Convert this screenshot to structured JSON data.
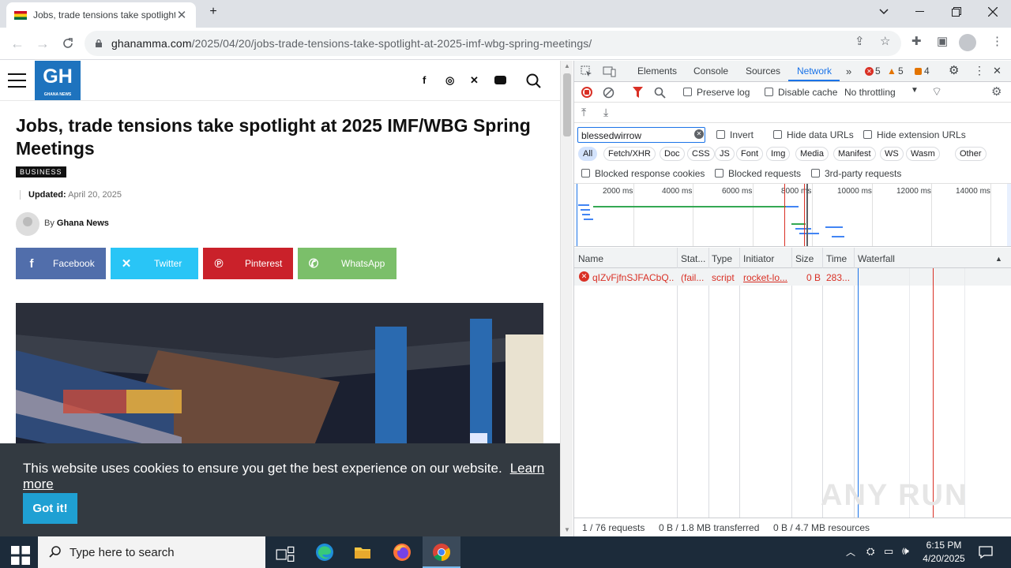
{
  "browser": {
    "tab_title": "Jobs, trade tensions take spotlight",
    "url_domain": "ghanamma.com",
    "url_path": "/2025/04/20/jobs-trade-tensions-take-spotlight-at-2025-imf-wbg-spring-meetings/"
  },
  "site": {
    "logo_text": "GH",
    "logo_sub": "GHANA NEWS",
    "headline": "Jobs, trade tensions take spotlight at 2025 IMF/WBG Spring Meetings",
    "category": "BUSINESS",
    "updated_label": "Updated:",
    "updated_date": "April 20, 2025",
    "by_label": "By",
    "author": "Ghana News",
    "share": {
      "facebook": "Facebook",
      "twitter": "Twitter",
      "pinterest": "Pinterest",
      "whatsapp": "WhatsApp"
    },
    "cookie_message": "This website uses cookies to ensure you get the best experience on our website.",
    "cookie_learn_more": "Learn more",
    "cookie_button": "Got it!"
  },
  "devtools": {
    "tabs": [
      "Elements",
      "Console",
      "Sources",
      "Network"
    ],
    "active_tab": "Network",
    "error_count": "5",
    "warning_count": "5",
    "issue_count": "4",
    "preserve_log": "Preserve log",
    "disable_cache": "Disable cache",
    "throttling": "No throttling",
    "filter_value": "blessedwirrow",
    "invert": "Invert",
    "hide_data_urls": "Hide data URLs",
    "hide_extension_urls": "Hide extension URLs",
    "type_filters": [
      "All",
      "Fetch/XHR",
      "Doc",
      "CSS",
      "JS",
      "Font",
      "Img",
      "Media",
      "Manifest",
      "WS",
      "Wasm",
      "Other"
    ],
    "active_type_filter": "All",
    "blocked_response_cookies": "Blocked response cookies",
    "blocked_requests": "Blocked requests",
    "third_party_requests": "3rd-party requests",
    "timeline_ticks": [
      "2000 ms",
      "4000 ms",
      "6000 ms",
      "8000 ms",
      "10000 ms",
      "12000 ms",
      "14000 ms"
    ],
    "columns": [
      "Name",
      "Stat...",
      "Type",
      "Initiator",
      "Size",
      "Time",
      "Waterfall"
    ],
    "rows": [
      {
        "name": "qIZvFjfnSJFACbQ...",
        "status": "(fail...",
        "type": "script",
        "initiator": "rocket-lo...",
        "size": "0 B",
        "time": "283..."
      }
    ],
    "status_requests": "1 / 76 requests",
    "status_transferred": "0 B / 1.8 MB transferred",
    "status_resources": "0 B / 4.7 MB resources",
    "watermark": "ANY RUN"
  },
  "taskbar": {
    "search_placeholder": "Type here to search",
    "time": "6:15 PM",
    "date": "4/20/2025"
  },
  "colors": {
    "facebook": "#516eab",
    "twitter": "#29c5f6",
    "pinterest": "#ca212a",
    "whatsapp": "#7bbf6a",
    "devtools_accent": "#1a73e8",
    "error_red": "#d93025"
  }
}
